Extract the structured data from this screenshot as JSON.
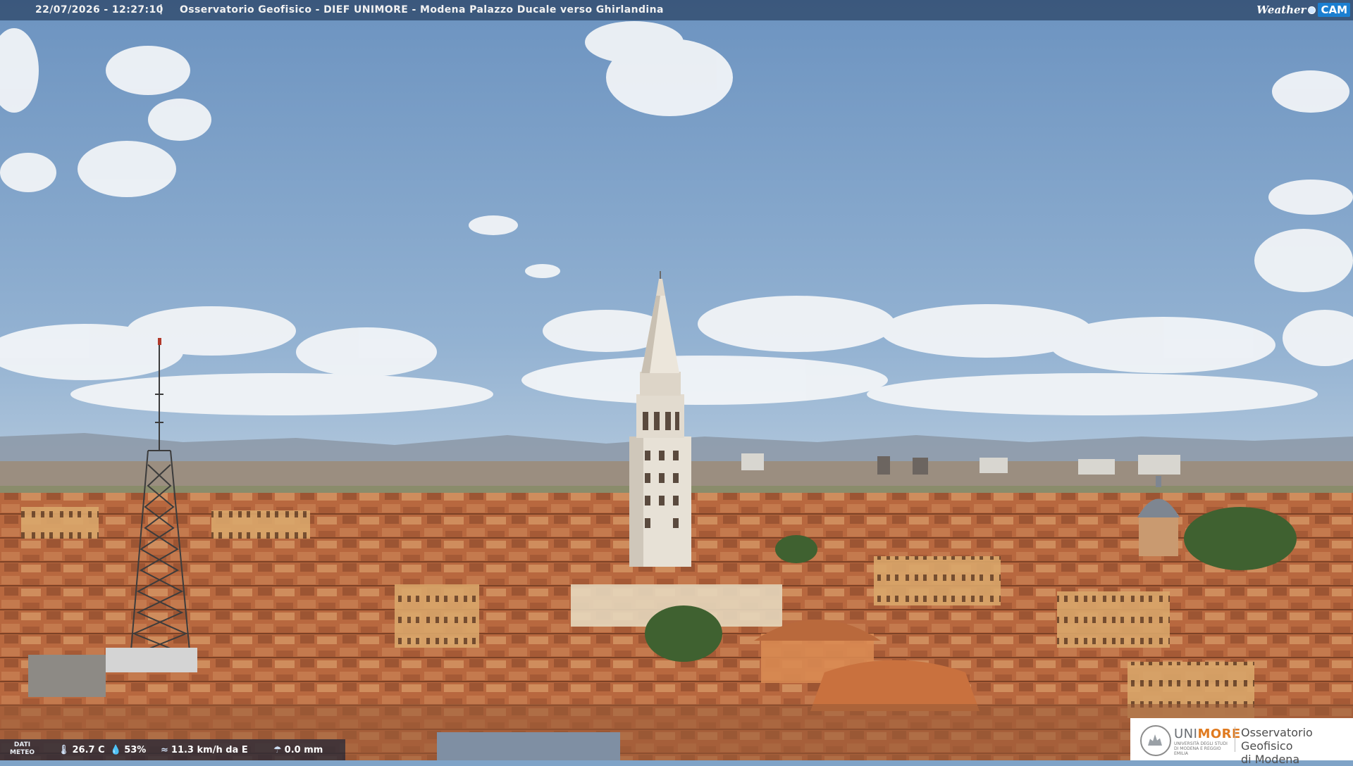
{
  "overlay": {
    "timestamp": "22/07/2026 - 12:27:10",
    "separator": "|",
    "title": "Osservatorio Geofisico - DIEF UNIMORE - Modena Palazzo Ducale verso Ghirlandina"
  },
  "weathercam_logo": {
    "word": "Weather",
    "cam": "CAM"
  },
  "meteo": {
    "label_line1": "DATI",
    "label_line2": "METEO",
    "temperature": "26.7 C",
    "humidity": "53%",
    "wind": "11.3 km/h da E",
    "rain": "0.0 mm",
    "icons": [
      "thermometer-icon",
      "humidity-drop-icon",
      "wind-icon",
      "rain-gauge-icon"
    ]
  },
  "unimore_logo": {
    "brand_a": "UNI",
    "brand_b": "MORE",
    "brand_sub": "UNIVERSITÀ DEGLI STUDI DI MODENA E REGGIO EMILIA",
    "observatory_line1": "Osservatorio Geofisico",
    "observatory_line2": "di Modena"
  },
  "colors": {
    "sky_top": "#6f96c2",
    "sky_bottom": "#c9d7e3",
    "roofs": "#b5643a",
    "brand_orange": "#e07a1f"
  }
}
